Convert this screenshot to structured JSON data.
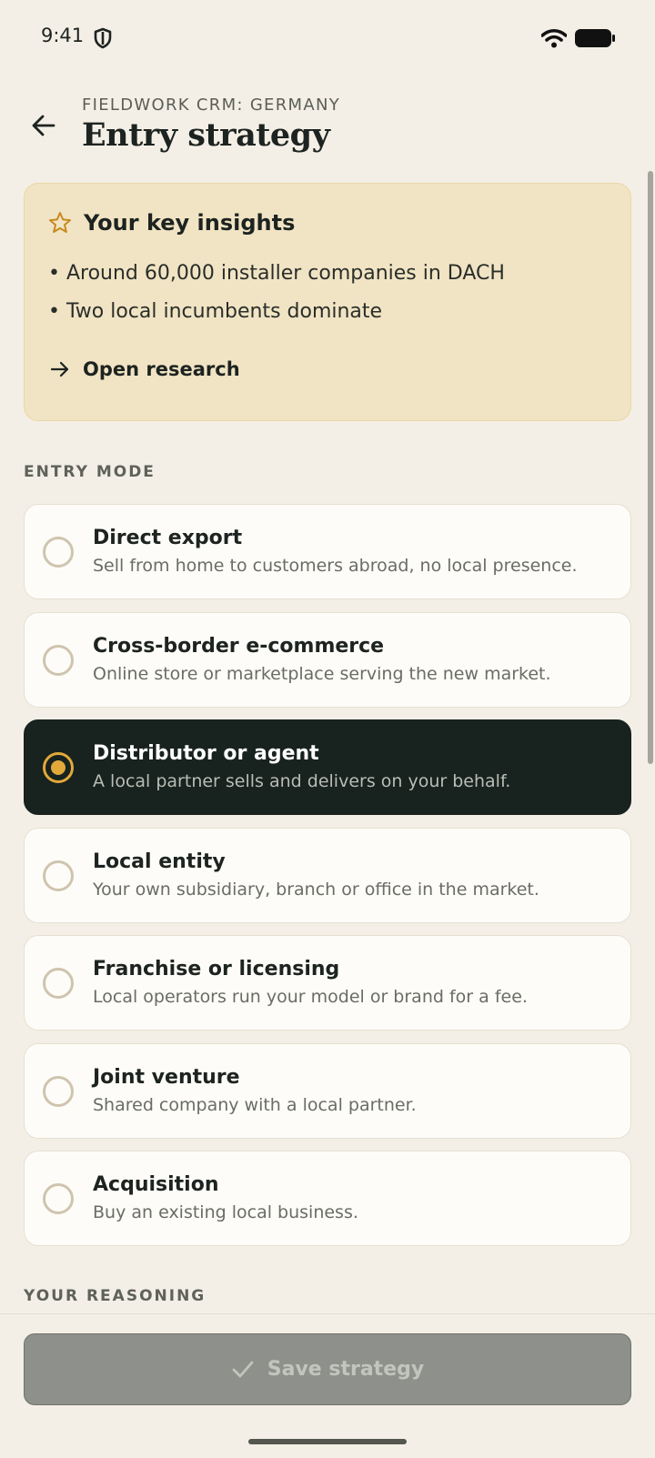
{
  "status_bar": {
    "time": "9:41"
  },
  "header": {
    "subtitle": "FIELDWORK CRM: GERMANY",
    "title": "Entry strategy"
  },
  "insights": {
    "title": "Your key insights",
    "items": [
      "• Around 60,000 installer companies in DACH",
      "• Two local incumbents dominate"
    ],
    "link_label": "Open research"
  },
  "entry_mode": {
    "label": "ENTRY MODE",
    "selected_index": 2,
    "options": [
      {
        "title": "Direct export",
        "description": "Sell from home to customers abroad, no local presence."
      },
      {
        "title": "Cross-border e-commerce",
        "description": "Online store or marketplace serving the new market."
      },
      {
        "title": "Distributor or agent",
        "description": "A local partner sells and delivers on your behalf."
      },
      {
        "title": "Local entity",
        "description": "Your own subsidiary, branch or office in the market."
      },
      {
        "title": "Franchise or licensing",
        "description": "Local operators run your model or brand for a fee."
      },
      {
        "title": "Joint venture",
        "description": "Shared company with a local partner."
      },
      {
        "title": "Acquisition",
        "description": "Buy an existing local business."
      }
    ]
  },
  "reasoning": {
    "label": "YOUR REASONING"
  },
  "save_button": {
    "label": "Save strategy",
    "enabled": false
  },
  "colors": {
    "accent": "#e1a93a",
    "selected_bg": "#18221e",
    "insights_bg": "#f1e4c4",
    "page_bg": "#f4efe6"
  }
}
